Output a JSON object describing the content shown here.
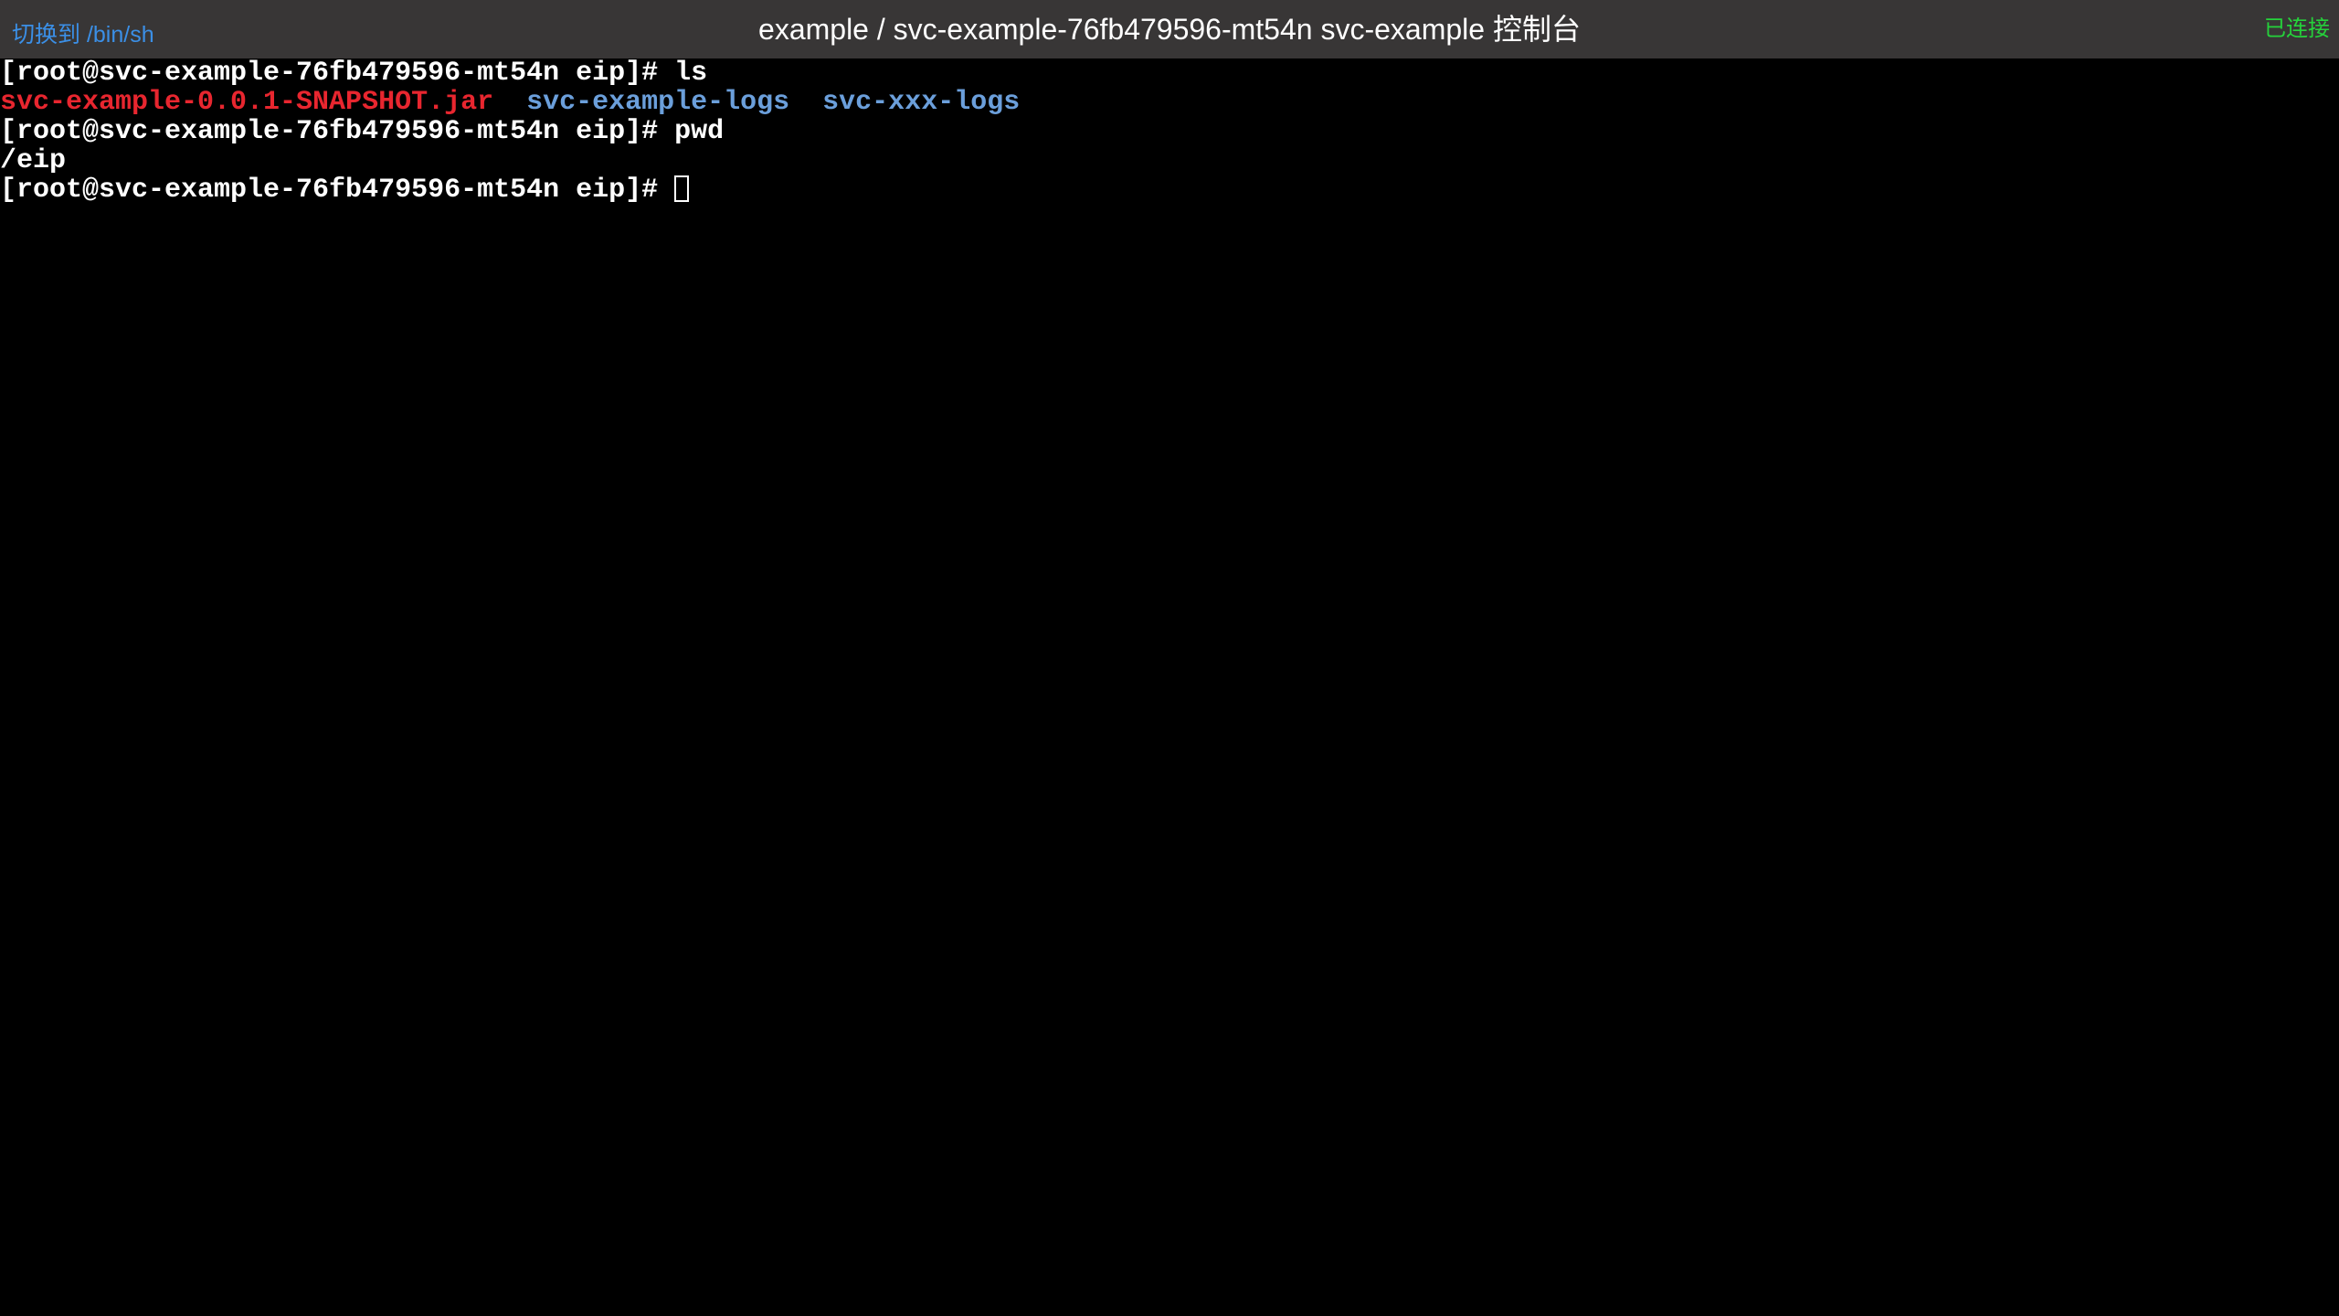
{
  "titlebar": {
    "switch_shell_label": "切换到 /bin/sh",
    "title": "example / svc-example-76fb479596-mt54n svc-example 控制台",
    "connection_status": "已连接"
  },
  "terminal": {
    "prompt": "[root@svc-example-76fb479596-mt54n eip]# ",
    "lines": [
      {
        "command": "ls"
      },
      {
        "files": [
          "svc-example-0.0.1-SNAPSHOT.jar",
          "svc-example-logs",
          "svc-xxx-logs"
        ]
      },
      {
        "command": "pwd"
      },
      {
        "output": "/eip"
      },
      {
        "command": ""
      }
    ],
    "separator": "  "
  },
  "colors": {
    "titlebar_bg": "#383636",
    "terminal_bg": "#000000",
    "link": "#3b8fe6",
    "connected": "#25d23b",
    "jar_file": "#e8262f",
    "directory": "#6b9fdb"
  }
}
